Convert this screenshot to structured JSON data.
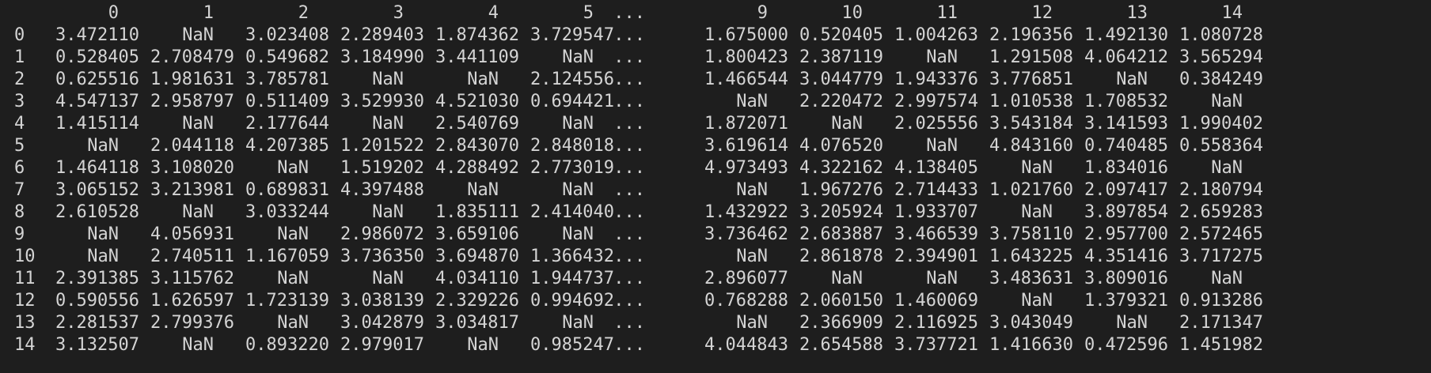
{
  "dataframe": {
    "columns": [
      "0",
      "1",
      "2",
      "3",
      "4",
      "5",
      "...",
      "9",
      "10",
      "11",
      "12",
      "13",
      "14"
    ],
    "rows": [
      {
        "index": "0",
        "values": [
          "3.472110",
          "NaN",
          "3.023408",
          "2.289403",
          "1.874362",
          "3.729547",
          "...",
          "1.675000",
          "0.520405",
          "1.004263",
          "2.196356",
          "1.492130",
          "1.080728"
        ]
      },
      {
        "index": "1",
        "values": [
          "0.528405",
          "2.708479",
          "0.549682",
          "3.184990",
          "3.441109",
          "NaN",
          "...",
          "1.800423",
          "2.387119",
          "NaN",
          "1.291508",
          "4.064212",
          "3.565294"
        ]
      },
      {
        "index": "2",
        "values": [
          "0.625516",
          "1.981631",
          "3.785781",
          "NaN",
          "NaN",
          "2.124556",
          "...",
          "1.466544",
          "3.044779",
          "1.943376",
          "3.776851",
          "NaN",
          "0.384249"
        ]
      },
      {
        "index": "3",
        "values": [
          "4.547137",
          "2.958797",
          "0.511409",
          "3.529930",
          "4.521030",
          "0.694421",
          "...",
          "NaN",
          "2.220472",
          "2.997574",
          "1.010538",
          "1.708532",
          "NaN"
        ]
      },
      {
        "index": "4",
        "values": [
          "1.415114",
          "NaN",
          "2.177644",
          "NaN",
          "2.540769",
          "NaN",
          "...",
          "1.872071",
          "NaN",
          "2.025556",
          "3.543184",
          "3.141593",
          "1.990402"
        ]
      },
      {
        "index": "5",
        "values": [
          "NaN",
          "2.044118",
          "4.207385",
          "1.201522",
          "2.843070",
          "2.848018",
          "...",
          "3.619614",
          "4.076520",
          "NaN",
          "4.843160",
          "0.740485",
          "0.558364"
        ]
      },
      {
        "index": "6",
        "values": [
          "1.464118",
          "3.108020",
          "NaN",
          "1.519202",
          "4.288492",
          "2.773019",
          "...",
          "4.973493",
          "4.322162",
          "4.138405",
          "NaN",
          "1.834016",
          "NaN"
        ]
      },
      {
        "index": "7",
        "values": [
          "3.065152",
          "3.213981",
          "0.689831",
          "4.397488",
          "NaN",
          "NaN",
          "...",
          "NaN",
          "1.967276",
          "2.714433",
          "1.021760",
          "2.097417",
          "2.180794"
        ]
      },
      {
        "index": "8",
        "values": [
          "2.610528",
          "NaN",
          "3.033244",
          "NaN",
          "1.835111",
          "2.414040",
          "...",
          "1.432922",
          "3.205924",
          "1.933707",
          "NaN",
          "3.897854",
          "2.659283"
        ]
      },
      {
        "index": "9",
        "values": [
          "NaN",
          "4.056931",
          "NaN",
          "2.986072",
          "3.659106",
          "NaN",
          "...",
          "3.736462",
          "2.683887",
          "3.466539",
          "3.758110",
          "2.957700",
          "2.572465"
        ]
      },
      {
        "index": "10",
        "values": [
          "NaN",
          "2.740511",
          "1.167059",
          "3.736350",
          "3.694870",
          "1.366432",
          "...",
          "NaN",
          "2.861878",
          "2.394901",
          "1.643225",
          "4.351416",
          "3.717275"
        ]
      },
      {
        "index": "11",
        "values": [
          "2.391385",
          "3.115762",
          "NaN",
          "NaN",
          "4.034110",
          "1.944737",
          "...",
          "2.896077",
          "NaN",
          "NaN",
          "3.483631",
          "3.809016",
          "NaN"
        ]
      },
      {
        "index": "12",
        "values": [
          "0.590556",
          "1.626597",
          "1.723139",
          "3.038139",
          "2.329226",
          "0.994692",
          "...",
          "0.768288",
          "2.060150",
          "1.460069",
          "NaN",
          "1.379321",
          "0.913286"
        ]
      },
      {
        "index": "13",
        "values": [
          "2.281537",
          "2.799376",
          "NaN",
          "3.042879",
          "3.034817",
          "NaN",
          "...",
          "NaN",
          "2.366909",
          "2.116925",
          "3.043049",
          "NaN",
          "2.171347"
        ]
      },
      {
        "index": "14",
        "values": [
          "3.132507",
          "NaN",
          "0.893220",
          "2.979017",
          "NaN",
          "0.985247",
          "...",
          "4.044843",
          "2.654588",
          "3.737721",
          "1.416630",
          "0.472596",
          "1.451982"
        ]
      }
    ]
  },
  "colors": {
    "background": "#1e1e1e",
    "text": "#d4d4d4"
  }
}
